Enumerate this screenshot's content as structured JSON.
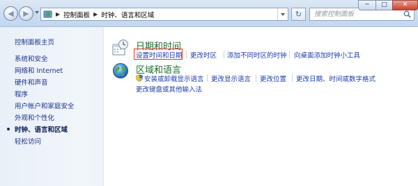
{
  "window": {
    "minimize_symbol": "─",
    "maximize_symbol": "□",
    "close_symbol": "✕"
  },
  "nav": {
    "back_symbol": "◀",
    "forward_symbol": "▶"
  },
  "address_bar": {
    "crumbs": [
      "控制面板",
      "时钟、语言和区域"
    ],
    "separator": "▶"
  },
  "refresh_symbol": "↻",
  "search": {
    "placeholder": "搜索控制面板"
  },
  "sidebar": {
    "items": [
      {
        "label": "控制面板主页"
      },
      {
        "label": "系统和安全"
      },
      {
        "label": "网络和 Internet"
      },
      {
        "label": "硬件和声音"
      },
      {
        "label": "程序"
      },
      {
        "label": "用户帐户和家庭安全"
      },
      {
        "label": "外观和个性化"
      },
      {
        "label": "时钟、语言和区域",
        "current": true
      },
      {
        "label": "轻松访问"
      }
    ]
  },
  "categories": {
    "datetime": {
      "title": "日期和时间",
      "tasks": [
        "设置时间和日期",
        "更改时区",
        "添加不同时区的时钟",
        "向桌面添加时钟小工具"
      ]
    },
    "region": {
      "title": "区域和语言",
      "tasks": [
        "安装或卸载显示语言",
        "更改显示语言",
        "更改位置",
        "更改日期、时间或数字格式",
        "更改键盘或其他输入法"
      ]
    }
  },
  "colors": {
    "category_title": "#1e6e2b",
    "task_link": "#1a3dab",
    "sidebar_link": "#1e3287",
    "highlight_box": "#d93a2c"
  }
}
